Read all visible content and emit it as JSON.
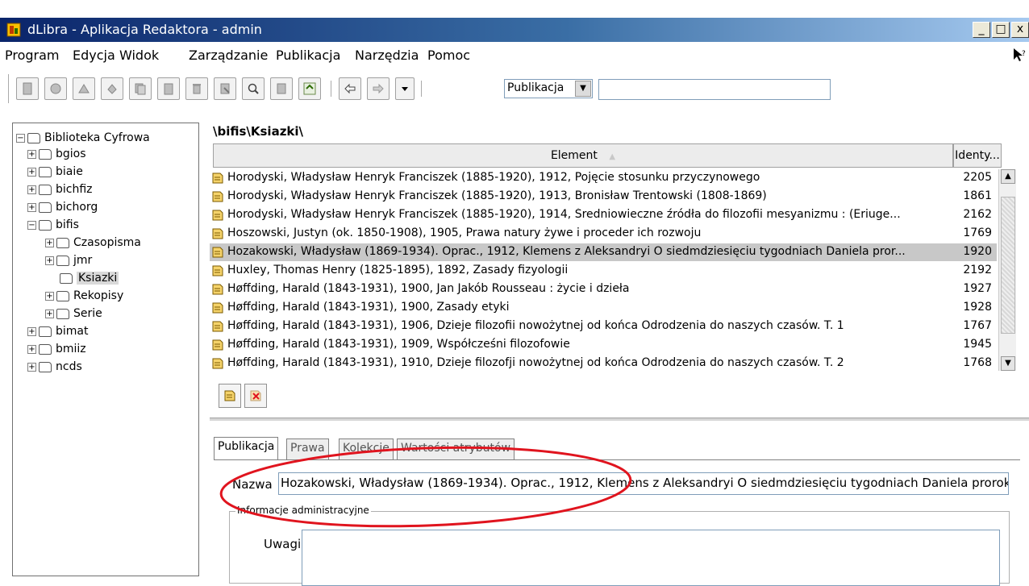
{
  "window": {
    "title": "dLibra - Aplikacja Redaktora - admin",
    "minimize": "_",
    "maximize": "□",
    "close": "x"
  },
  "menu": [
    "Program",
    "Edycja",
    "Widok",
    "Zarządzanie",
    "Publikacja",
    "Narzędzia",
    "Pomoc"
  ],
  "toolbar": {
    "search_scope": "Publikacja",
    "search_value": ""
  },
  "tree": {
    "root": "Biblioteka Cyfrowa",
    "nodes": {
      "bgios": "bgios",
      "biaie": "biaie",
      "bichfiz": "bichfiz",
      "bichorg": "bichorg",
      "bifis": "bifis",
      "czasopisma": "Czasopisma",
      "jmr": "jmr",
      "ksiazki": "Ksiazki",
      "rekopisy": "Rekopisy",
      "serie": "Serie",
      "bimat": "bimat",
      "bmiiz": "bmiiz",
      "ncds": "ncds"
    }
  },
  "path": "\\bifis\\Ksiazki\\",
  "table": {
    "columns": [
      "Element",
      "Identy..."
    ],
    "rows": [
      {
        "element": "Horodyski, Władysław Henryk Franciszek (1885-1920), 1912, Pojęcie stosunku przyczynowego",
        "id": "2205"
      },
      {
        "element": "Horodyski, Władysław Henryk Franciszek (1885-1920), 1913, Bronisław Trentowski (1808-1869)",
        "id": "1861"
      },
      {
        "element": "Horodyski, Władysław Henryk Franciszek (1885-1920), 1914, Średniowieczne źródła do filozofii mesyanizmu : (Eriuge...",
        "id": "2162"
      },
      {
        "element": "Hoszowski, Justyn (ok. 1850-1908), 1905, Prawa natury żywe i proceder ich rozwoju",
        "id": "1769"
      },
      {
        "element": "Hozakowski, Władysław (1869-1934). Oprac., 1912, Klemens z Aleksandryi O siedmdziesięciu tygodniach Daniela pror...",
        "id": "1920"
      },
      {
        "element": "Huxley, Thomas Henry (1825-1895), 1892, Zasady fizyologii",
        "id": "2192"
      },
      {
        "element": "Høffding, Harald (1843-1931), 1900, Jan Jakób Rousseau : życie i dzieła",
        "id": "1927"
      },
      {
        "element": "Høffding, Harald (1843-1931), 1900, Zasady etyki",
        "id": "1928"
      },
      {
        "element": "Høffding, Harald (1843-1931), 1906, Dzieje filozofii nowożytnej od końca Odrodzenia do naszych czasów. T. 1",
        "id": "1767"
      },
      {
        "element": "Høffding, Harald (1843-1931), 1909, Współcześni filozofowie",
        "id": "1945"
      },
      {
        "element": "Høffding, Harald (1843-1931), 1910, Dzieje filozofji nowożytnej od końca Odrodzenia do naszych czasów. T. 2",
        "id": "1768"
      }
    ],
    "selected_index": 4
  },
  "tabs": [
    "Publikacja",
    "Prawa",
    "Kolekcje",
    "Wartości atrybutów"
  ],
  "details": {
    "nazwa_label": "Nazwa",
    "nazwa_value": "Hozakowski, Władysław (1869-1934). Oprac., 1912, Klemens z Aleksandryi O siedmdziesięciu tygodniach Daniela proroka",
    "admin_group": "Informacje administracyjne",
    "uwagi_label": "Uwagi",
    "uwagi_value": ""
  },
  "colors": {
    "annotation": "#e0141e",
    "selection": "#c8c8c8"
  }
}
